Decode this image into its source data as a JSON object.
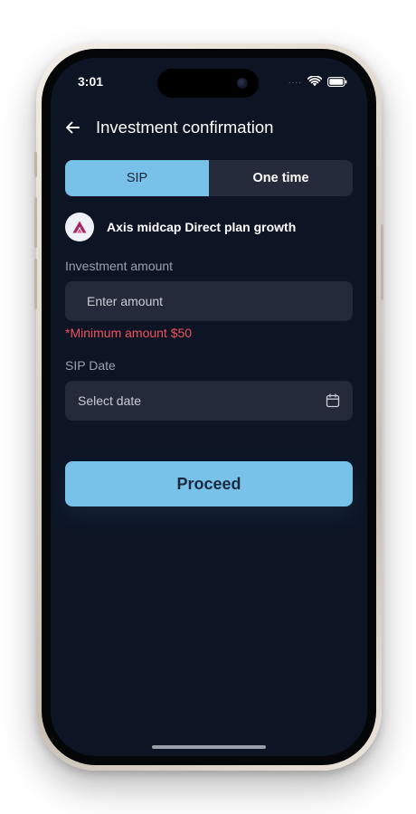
{
  "status_bar": {
    "time": "3:01",
    "signal": "....",
    "wifi_icon": "wifi-icon",
    "battery_icon": "battery-icon"
  },
  "header": {
    "back_icon": "arrow-left-icon",
    "title": "Investment confirmation"
  },
  "tabs": [
    {
      "label": "SIP",
      "active": true
    },
    {
      "label": "One time",
      "active": false
    }
  ],
  "fund": {
    "logo_icon": "axis-logo-icon",
    "name": "Axis midcap Direct plan growth"
  },
  "investment_amount": {
    "label": "Investment amount",
    "placeholder": "Enter amount",
    "value": "",
    "error": "*Minimum amount $50"
  },
  "sip_date": {
    "label": "SIP Date",
    "placeholder": "Select date",
    "icon": "calendar-icon"
  },
  "actions": {
    "proceed_label": "Proceed"
  },
  "colors": {
    "background": "#0d1525",
    "accent": "#78c2ea",
    "input_bg": "#252a3a",
    "error": "#f0505a",
    "logo_brand": "#a52460"
  }
}
